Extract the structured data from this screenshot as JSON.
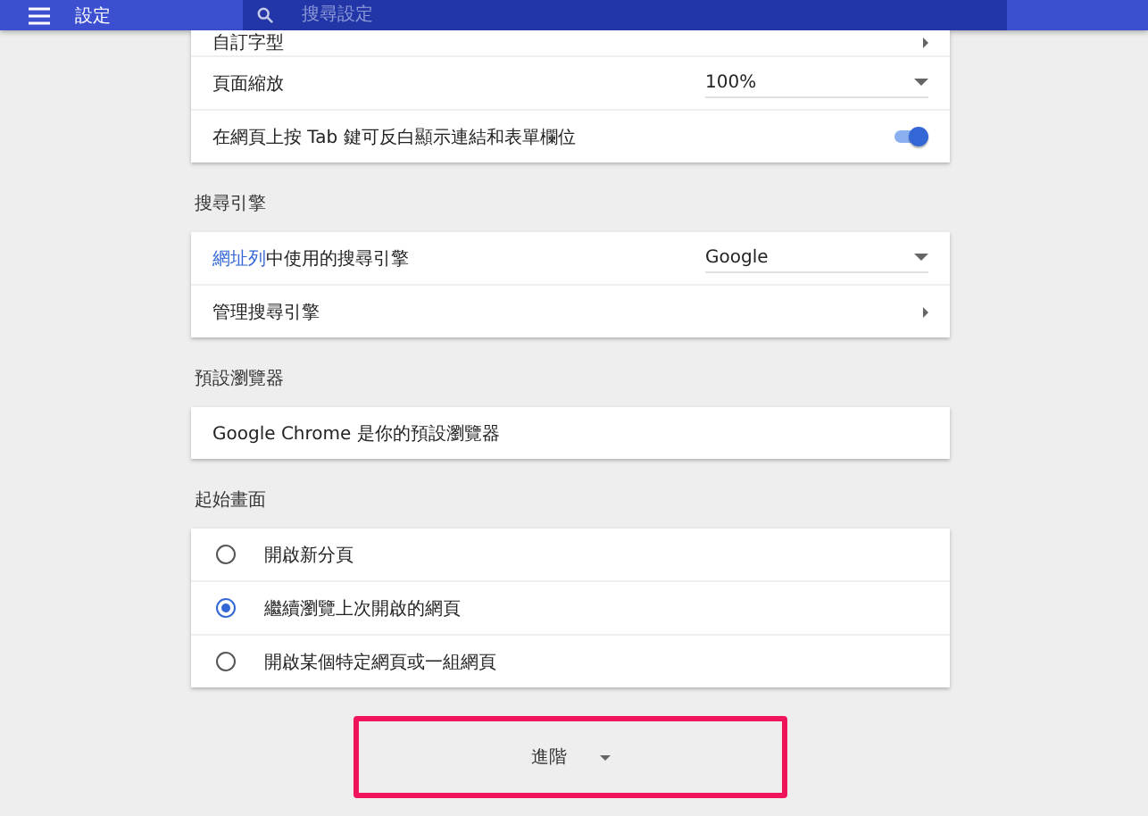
{
  "header": {
    "title": "設定",
    "search": {
      "placeholder": "搜尋設定"
    }
  },
  "sections": [
    {
      "rows": [
        {
          "kind": "link",
          "label": "自訂字型"
        },
        {
          "kind": "select",
          "label": "頁面縮放",
          "value": "100%"
        },
        {
          "kind": "toggle",
          "label": "在網頁上按 Tab 鍵可反白顯示連結和表單欄位",
          "on": true
        }
      ]
    },
    {
      "heading": "搜尋引擎",
      "rows": [
        {
          "kind": "select",
          "link": "網址列",
          "rest": "中使用的搜尋引擎",
          "value": "Google"
        },
        {
          "kind": "link",
          "label": "管理搜尋引擎"
        }
      ]
    },
    {
      "heading": "預設瀏覽器",
      "rows": [
        {
          "kind": "text",
          "label": "Google Chrome 是你的預設瀏覽器"
        }
      ]
    },
    {
      "heading": "起始畫面",
      "rows": [
        {
          "kind": "radio",
          "label": "開啟新分頁",
          "selected": false
        },
        {
          "kind": "radio",
          "label": "繼續瀏覽上次開啟的網頁",
          "selected": true
        },
        {
          "kind": "radio",
          "label": "開啟某個特定網頁或一組網頁",
          "selected": false
        }
      ]
    }
  ],
  "advanced": {
    "label": "進階"
  }
}
